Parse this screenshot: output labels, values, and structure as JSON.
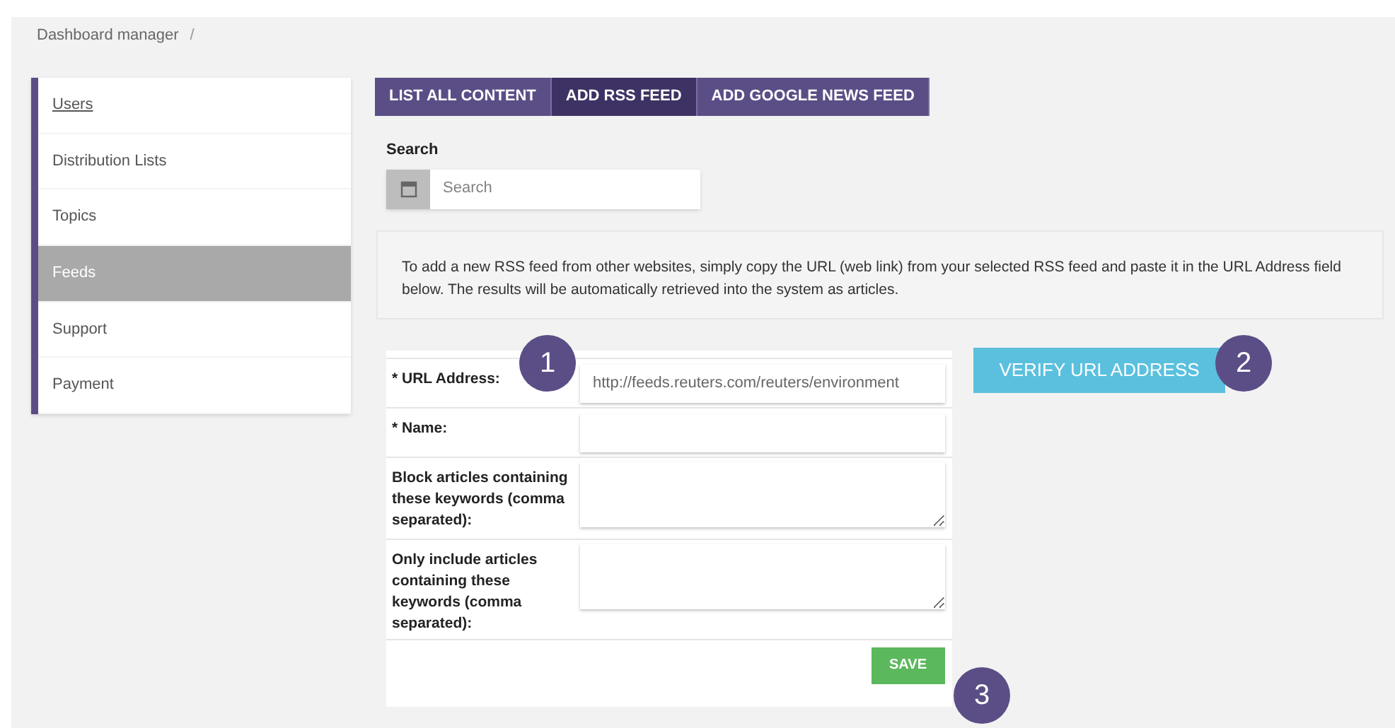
{
  "breadcrumb": [
    "Dashboard manager"
  ],
  "breadcrumb_separator": "/",
  "sidebar": {
    "items": [
      {
        "label": "Users",
        "selected": false,
        "link": true
      },
      {
        "label": "Distribution Lists",
        "selected": false,
        "link": false
      },
      {
        "label": "Topics",
        "selected": false,
        "link": false
      },
      {
        "label": "Feeds",
        "selected": true,
        "link": false
      },
      {
        "label": "Support",
        "selected": false,
        "link": false
      },
      {
        "label": "Payment",
        "selected": false,
        "link": false
      }
    ]
  },
  "tabs": [
    {
      "label": "LIST ALL CONTENT",
      "selected": false
    },
    {
      "label": "ADD RSS FEED",
      "selected": true
    },
    {
      "label": "ADD GOOGLE NEWS FEED",
      "selected": false
    }
  ],
  "search": {
    "label": "Search",
    "placeholder": "Search"
  },
  "info": "To add a new RSS feed from other websites, simply copy the URL (web link) from your selected RSS feed and paste it in the URL Address field below. The results will be automatically retrieved into the system as articles.",
  "form": {
    "fields": [
      {
        "kind": "input",
        "label": "* URL Address:",
        "value": "http://feeds.reuters.com/reuters/environment"
      },
      {
        "kind": "input",
        "label": "* Name:"
      },
      {
        "kind": "textarea",
        "label": "Block articles containing these keywords (comma separated):"
      },
      {
        "kind": "textarea",
        "label": "Only include articles containing these keywords (comma separated):"
      }
    ],
    "save_button": "SAVE"
  },
  "verify_button": "VERIFY URL ADDRESS",
  "callouts": [
    "1",
    "2",
    "3"
  ]
}
